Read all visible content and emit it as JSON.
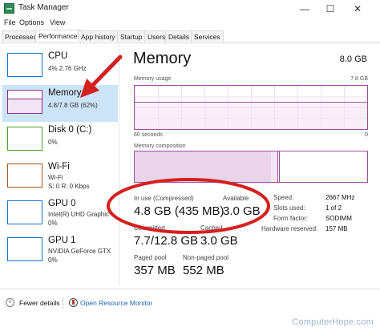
{
  "window": {
    "title": "Task Manager",
    "controls": {
      "minimize": "—",
      "maximize": "☐",
      "close": "✕"
    }
  },
  "menu": [
    "File",
    "Options",
    "View"
  ],
  "tabs": [
    {
      "label": "Processes"
    },
    {
      "label": "Performance"
    },
    {
      "label": "App history"
    },
    {
      "label": "Startup"
    },
    {
      "label": "Users"
    },
    {
      "label": "Details"
    },
    {
      "label": "Services"
    }
  ],
  "sidebar": {
    "items": [
      {
        "name": "CPU",
        "sub1": "4%  2.76 GHz",
        "sub2": "",
        "color": "#1174d4",
        "selected": false,
        "icon": "cpu-graph-icon"
      },
      {
        "name": "Memory",
        "sub1": "4.8/7.8 GB (62%)",
        "sub2": "",
        "color": "#8b2c8b",
        "selected": true,
        "icon": "memory-graph-icon"
      },
      {
        "name": "Disk 0 (C:)",
        "sub1": "0%",
        "sub2": "",
        "color": "#4c9a2a",
        "selected": false,
        "icon": "disk-graph-icon"
      },
      {
        "name": "Wi-Fi",
        "sub1": "Wi-Fi",
        "sub2": "S: 0  R: 0 Kbps",
        "color": "#a6591b",
        "selected": false,
        "icon": "wifi-graph-icon"
      },
      {
        "name": "GPU 0",
        "sub1": "Intel(R) UHD Graphic",
        "sub2": "0%",
        "color": "#1174d4",
        "selected": false,
        "icon": "gpu0-graph-icon"
      },
      {
        "name": "GPU 1",
        "sub1": "NVIDIA GeForce GTX",
        "sub2": "0%",
        "color": "#1174d4",
        "selected": false,
        "icon": "gpu1-graph-icon"
      }
    ]
  },
  "memory": {
    "heading": "Memory",
    "total": "8.0 GB",
    "usage_label": "Memory usage",
    "usage_max": "7.8 GB",
    "time_label": "60 seconds",
    "time_end": "0",
    "usage_level": 0.62,
    "composition_label": "Memory composition",
    "accent": "#9b4e9b",
    "stats": {
      "in_use_label": "In use (Compressed)",
      "in_use_value": "4.8 GB (435 MB)",
      "available_label": "Available",
      "available_value": "3.0 GB",
      "committed_label": "Committed",
      "committed_value": "7.7/12.8 GB",
      "cached_label": "Cached",
      "cached_value": "3.0 GB",
      "paged_label": "Paged pool",
      "paged_value": "357 MB",
      "nonpaged_label": "Non-paged pool",
      "nonpaged_value": "552 MB"
    },
    "side": {
      "speed_label": "Speed:",
      "speed_value": "2667 MHz",
      "slots_label": "Slots used:",
      "slots_value": "1 of 2",
      "form_label": "Form factor:",
      "form_value": "SODIMM",
      "reserved_label": "Hardware reserved:",
      "reserved_value": "157 MB"
    }
  },
  "footer": {
    "fewer_details": "Fewer details",
    "open_resource_monitor": "Open Resource Monitor"
  },
  "annotation": {
    "color": "#d42020"
  },
  "watermark": "ComputerHope.com"
}
